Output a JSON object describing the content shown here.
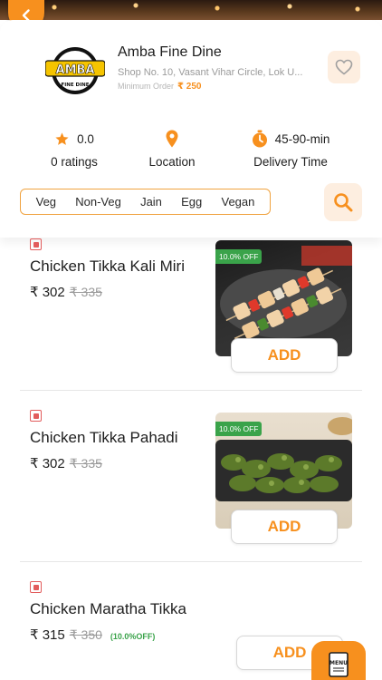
{
  "restaurant": {
    "name": "Amba Fine Dine",
    "address": "Shop No. 10, Vasant Vihar Circle, Lok U...",
    "min_order_label": "Minimum Order",
    "min_order_value": "₹ 250",
    "logo_text": "AMBA",
    "logo_subtext": "FINE DINE"
  },
  "stats": {
    "rating_value": "0.0",
    "ratings_label": "0 ratings",
    "location_label": "Location",
    "delivery_value": "45-90-min",
    "delivery_label": "Delivery Time"
  },
  "filters": [
    "Veg",
    "Non-Veg",
    "Jain",
    "Egg",
    "Vegan"
  ],
  "items": [
    {
      "name": "Chicken Tikka Kali Miri",
      "price": "₹ 302",
      "old_price": "₹ 335",
      "badge": "10.0% OFF",
      "add_label": "ADD"
    },
    {
      "name": "Chicken Tikka Pahadi",
      "price": "₹ 302",
      "old_price": "₹ 335",
      "badge": "10.0% OFF",
      "add_label": "ADD"
    },
    {
      "name": "Chicken Maratha Tikka",
      "price": "₹ 315",
      "old_price": "₹ 350",
      "off_note": "(10.0%OFF)",
      "add_label": "ADD"
    }
  ],
  "menu_fab_label": "MENU",
  "colors": {
    "accent": "#f7901e",
    "accent_light": "#fdeee0",
    "discount_green": "#3aa34a",
    "nonveg_red": "#e25c5c"
  }
}
